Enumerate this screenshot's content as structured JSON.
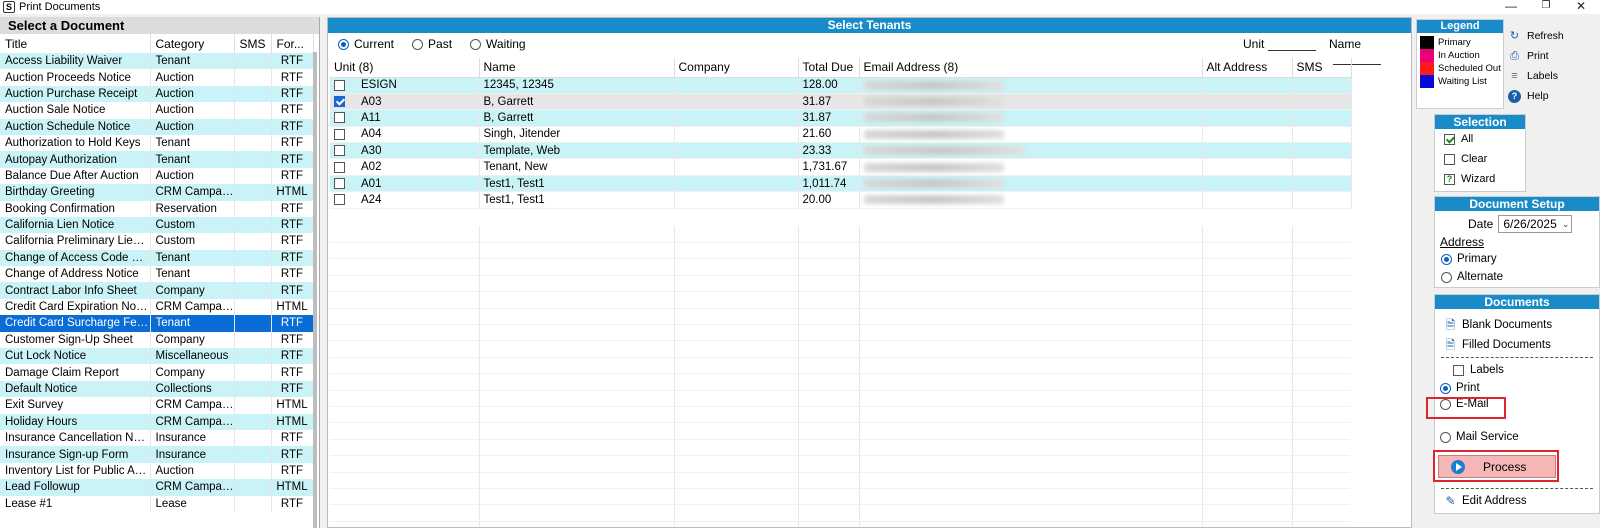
{
  "window": {
    "title": "Print Documents",
    "app_icon": "S",
    "minimize": "—",
    "restore": "❐",
    "close": "✕"
  },
  "left": {
    "header": "Select a Document",
    "columns": [
      "Title",
      "Category",
      "SMS",
      "For..."
    ],
    "rows": [
      {
        "title": "Access Liability Waiver",
        "category": "Tenant",
        "sms": "",
        "format": "RTF"
      },
      {
        "title": "Auction Proceeds Notice",
        "category": "Auction",
        "sms": "",
        "format": "RTF"
      },
      {
        "title": "Auction Purchase Receipt",
        "category": "Auction",
        "sms": "",
        "format": "RTF"
      },
      {
        "title": "Auction Sale Notice",
        "category": "Auction",
        "sms": "",
        "format": "RTF"
      },
      {
        "title": "Auction Schedule Notice",
        "category": "Auction",
        "sms": "",
        "format": "RTF"
      },
      {
        "title": "Authorization to Hold Keys",
        "category": "Tenant",
        "sms": "",
        "format": "RTF"
      },
      {
        "title": "Autopay Authorization",
        "category": "Tenant",
        "sms": "",
        "format": "RTF"
      },
      {
        "title": "Balance Due After Auction",
        "category": "Auction",
        "sms": "",
        "format": "RTF"
      },
      {
        "title": "Birthday Greeting",
        "category": "CRM Campai...",
        "sms": "",
        "format": "HTML"
      },
      {
        "title": "Booking Confirmation",
        "category": "Reservation",
        "sms": "",
        "format": "RTF"
      },
      {
        "title": "California Lien Notice",
        "category": "Custom",
        "sms": "",
        "format": "RTF"
      },
      {
        "title": "California Preliminary Lien ...",
        "category": "Custom",
        "sms": "",
        "format": "RTF"
      },
      {
        "title": "Change of Access Code No...",
        "category": "Tenant",
        "sms": "",
        "format": "RTF"
      },
      {
        "title": "Change of Address Notice",
        "category": "Tenant",
        "sms": "",
        "format": "RTF"
      },
      {
        "title": "Contract Labor Info Sheet",
        "category": "Company",
        "sms": "",
        "format": "RTF"
      },
      {
        "title": "Credit Card Expiration Notice",
        "category": "CRM Campai...",
        "sms": "",
        "format": "HTML"
      },
      {
        "title": "Credit Card Surcharge Fee ...",
        "category": "Tenant",
        "sms": "",
        "format": "RTF"
      },
      {
        "title": "Customer Sign-Up Sheet",
        "category": "Company",
        "sms": "",
        "format": "RTF"
      },
      {
        "title": "Cut Lock Notice",
        "category": "Miscellaneous",
        "sms": "",
        "format": "RTF"
      },
      {
        "title": "Damage Claim Report",
        "category": "Company",
        "sms": "",
        "format": "RTF"
      },
      {
        "title": "Default Notice",
        "category": "Collections",
        "sms": "",
        "format": "RTF"
      },
      {
        "title": "Exit Survey",
        "category": "CRM Campai...",
        "sms": "",
        "format": "HTML"
      },
      {
        "title": "Holiday Hours",
        "category": "CRM Campai...",
        "sms": "",
        "format": "HTML"
      },
      {
        "title": "Insurance Cancellation Noti...",
        "category": "Insurance",
        "sms": "",
        "format": "RTF"
      },
      {
        "title": "Insurance Sign-up Form",
        "category": "Insurance",
        "sms": "",
        "format": "RTF"
      },
      {
        "title": "Inventory List for Public Auct...",
        "category": "Auction",
        "sms": "",
        "format": "RTF"
      },
      {
        "title": "Lead Followup",
        "category": "CRM Campai...",
        "sms": "",
        "format": "HTML"
      },
      {
        "title": "Lease #1",
        "category": "Lease",
        "sms": "",
        "format": "RTF"
      }
    ],
    "selected_index": 16
  },
  "middle": {
    "header": "Select Tenants",
    "radios": [
      "Current",
      "Past",
      "Waiting"
    ],
    "radio_selected": 0,
    "unit_label": "Unit",
    "name_label": "Name",
    "unit_value": "",
    "name_value": "",
    "columns": [
      "Unit (8)",
      "Name",
      "Company",
      "Total Due",
      "Email Address (8)",
      "Alt Address",
      "SMS"
    ],
    "rows": [
      {
        "unit": "ESIGN",
        "name": "12345, 12345",
        "company": "",
        "total": "128.00",
        "email": "",
        "checked": false
      },
      {
        "unit": "A03",
        "name": "B, Garrett",
        "company": "",
        "total": "31.87",
        "email": "",
        "checked": true
      },
      {
        "unit": "A11",
        "name": "B, Garrett",
        "company": "",
        "total": "31.87",
        "email": "",
        "checked": false
      },
      {
        "unit": "A04",
        "name": "Singh, Jitender",
        "company": "",
        "total": "21.60",
        "email": "",
        "checked": false
      },
      {
        "unit": "A30",
        "name": "Template, Web",
        "company": "",
        "total": "23.33",
        "email": "",
        "checked": false
      },
      {
        "unit": "A02",
        "name": "Tenant, New",
        "company": "",
        "total": "1,731.67",
        "email": "",
        "checked": false
      },
      {
        "unit": "A01",
        "name": "Test1, Test1",
        "company": "",
        "total": "1,011.74",
        "email": "",
        "checked": false
      },
      {
        "unit": "A24",
        "name": "Test1, Test1",
        "company": "",
        "total": "20.00",
        "email": "",
        "checked": false
      }
    ]
  },
  "legend": {
    "header": "Legend",
    "items": [
      {
        "label": "Primary",
        "color": "#000000"
      },
      {
        "label": "In Auction",
        "color": "#e8007a"
      },
      {
        "label": "Scheduled Out",
        "color": "#ff1a1a"
      },
      {
        "label": "Waiting List",
        "color": "#0a0ad8"
      }
    ]
  },
  "tools": {
    "refresh": "Refresh",
    "print": "Print",
    "labels": "Labels",
    "help": "Help"
  },
  "selection": {
    "header": "Selection",
    "all": "All",
    "clear": "Clear",
    "wizard": "Wizard"
  },
  "doc_setup": {
    "header": "Document Setup",
    "date_label": "Date",
    "date_value": "6/26/2025",
    "address_label": "Address",
    "primary": "Primary",
    "alternate": "Alternate"
  },
  "documents": {
    "header": "Documents",
    "blank": "Blank Documents",
    "filled": "Filled Documents",
    "labels": "Labels",
    "print": "Print",
    "email": "E-Mail",
    "mail_service": "Mail Service",
    "process": "Process",
    "edit_address": "Edit Address"
  },
  "colors": {
    "accent": "#1a8bc9",
    "row_alt": "#c9f3f6",
    "selected_row": "#0a6cd6",
    "highlight": "#e0242e"
  }
}
